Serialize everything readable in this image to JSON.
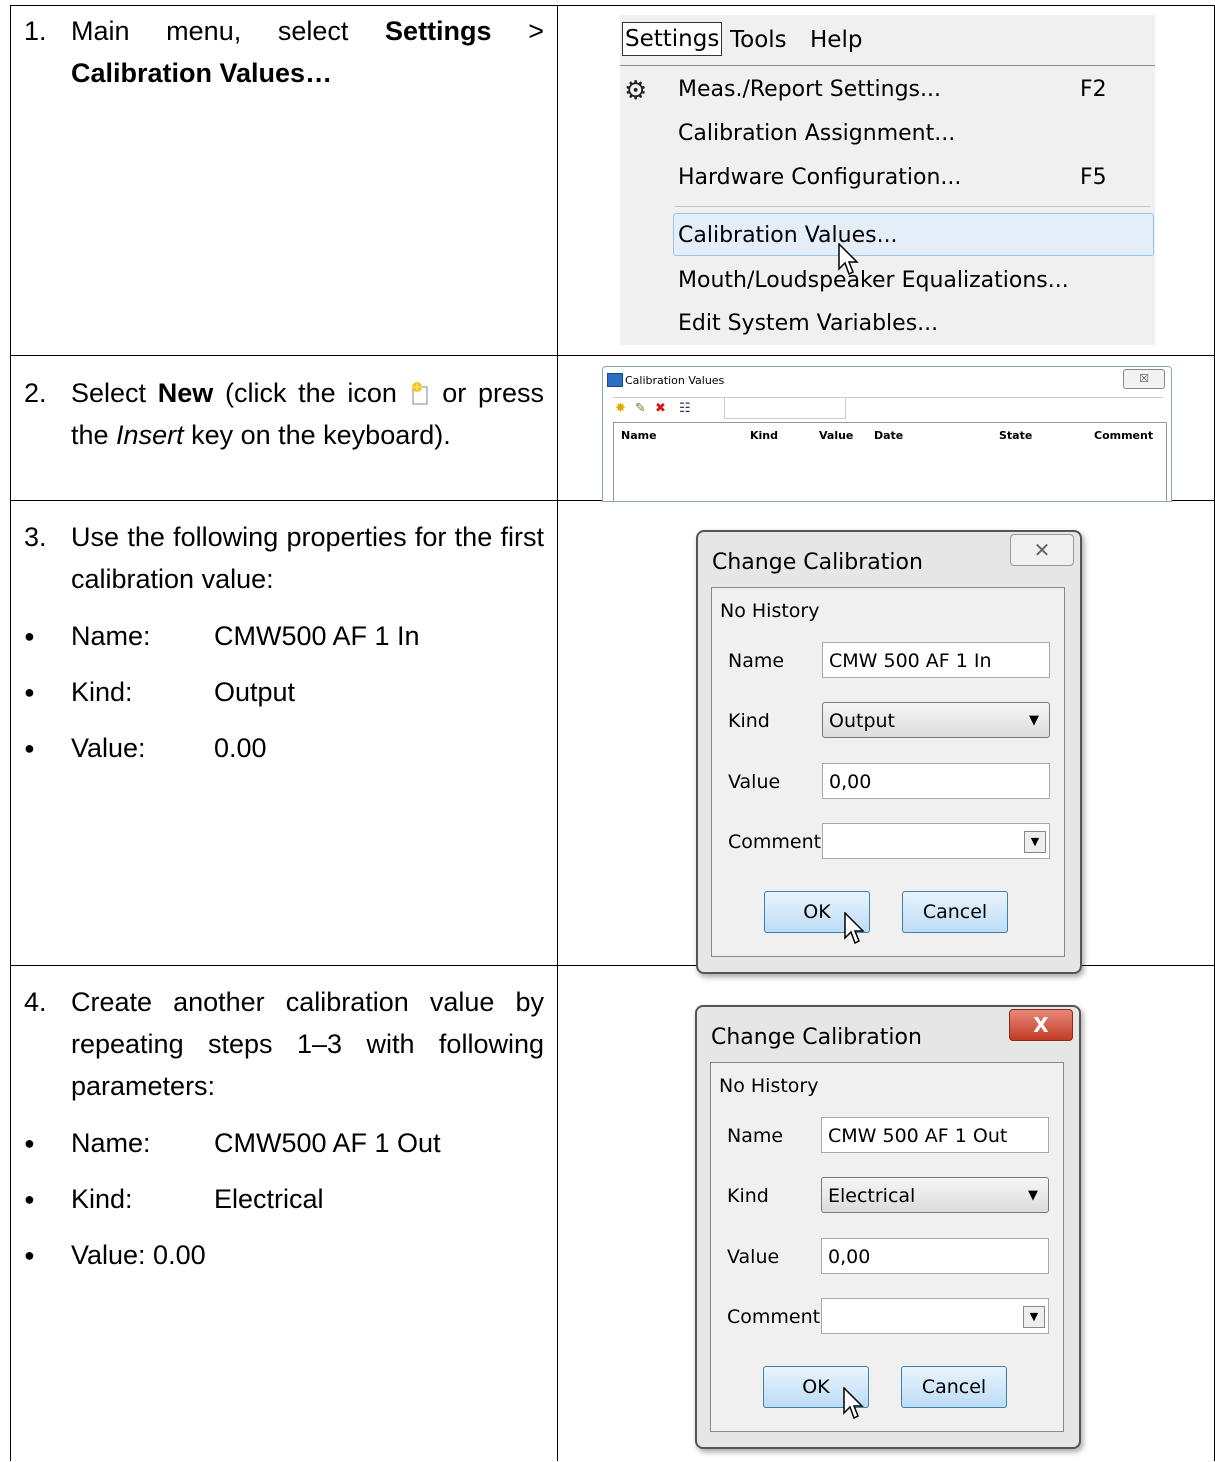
{
  "steps": [
    {
      "num": "1.",
      "text_prefix": "Main menu, select ",
      "bold1": "Settings",
      "sep": " > ",
      "bold2": "Calibration Values…"
    },
    {
      "num": "2.",
      "text_prefix": "Select ",
      "bold": "New",
      "text_mid": " (click the icon ",
      "text_mid2": " or press the ",
      "italic": "Insert",
      "text_suffix": " key on the keyboard)."
    },
    {
      "num": "3.",
      "text": "Use the following properties for the first calibration value:",
      "bullets": [
        {
          "label": "Name:",
          "value": "CMW500 AF 1 In"
        },
        {
          "label": "Kind:",
          "value": "Output"
        },
        {
          "label": "Value:",
          "value": "0.00"
        }
      ]
    },
    {
      "num": "4.",
      "text": "Create another calibration value by repeating steps 1–3 with following parameters:",
      "bullets": [
        {
          "label": "Name:",
          "value": "CMW500 AF 1 Out"
        },
        {
          "label": "Kind:",
          "value": "Electrical"
        },
        {
          "label": "Value: 0.00",
          "value": ""
        }
      ]
    }
  ],
  "menu": {
    "bar": {
      "settings": "Settings",
      "tools": "Tools",
      "help": "Help"
    },
    "items": [
      {
        "label": "Meas./Report Settings...",
        "key": "F2"
      },
      {
        "label": "Calibration Assignment...",
        "key": ""
      },
      {
        "label": "Hardware Configuration...",
        "key": "F5"
      },
      {
        "label": "Calibration Values...",
        "key": ""
      },
      {
        "label": "Mouth/Loudspeaker Equalizations...",
        "key": ""
      },
      {
        "label": "Edit System Variables...",
        "key": ""
      }
    ]
  },
  "cal_window": {
    "title": "Calibration Values",
    "close": "☒",
    "columns": [
      "Name",
      "Kind",
      "Value",
      "Date",
      "State",
      "Comment"
    ]
  },
  "dialog1": {
    "title": "Change Calibration",
    "close": "✕",
    "history": "No History",
    "name_label": "Name",
    "name_value": "CMW 500 AF 1 In",
    "kind_label": "Kind",
    "kind_value": "Output",
    "value_label": "Value",
    "value_value": "0,00",
    "comment_label": "Comment",
    "ok": "OK",
    "cancel": "Cancel"
  },
  "dialog2": {
    "title": "Change Calibration",
    "close": "X",
    "history": "No History",
    "name_label": "Name",
    "name_value": "CMW 500 AF 1 Out",
    "kind_label": "Kind",
    "kind_value": "Electrical",
    "value_label": "Value",
    "value_value": "0,00",
    "comment_label": "Comment",
    "ok": "OK",
    "cancel": "Cancel"
  }
}
